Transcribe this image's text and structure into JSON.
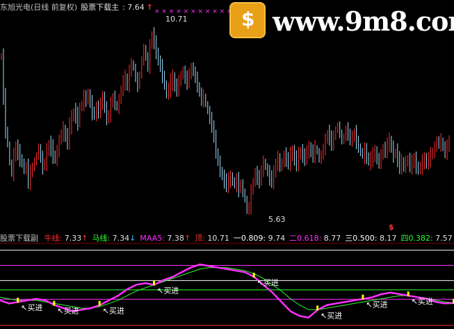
{
  "header": {
    "stock_name": "东旭光电(日线 前复权)",
    "indicator_label": "股票下载主",
    "indicator_value": ": 7.64",
    "up_arrow": "↑",
    "sell_marks": "× × × ×      × × ×  ×       × × ×"
  },
  "watermark": {
    "logo_text": "$",
    "site_text": "www.9m8.com"
  },
  "price_labels": {
    "high": "10.71",
    "low": "5.63"
  },
  "sub_header": {
    "title": "股票下载副",
    "items": [
      {
        "label": "牛线:",
        "value": "7.33",
        "arrow": "↑",
        "color": "#ff3030",
        "arrow_color": "#ff3030"
      },
      {
        "label": "马线:",
        "value": "7.34",
        "arrow": "↓",
        "color": "#30ff30",
        "arrow_color": "#30c0ff"
      },
      {
        "label": "MAA5:",
        "value": "7.38",
        "arrow": "↑",
        "color": "#ff30ff",
        "arrow_color": "#ff3030"
      },
      {
        "label": "顶:",
        "value": "10.71",
        "arrow": "",
        "color": "#ff3030",
        "arrow_color": "#ff3030"
      },
      {
        "label": "一0.809:",
        "value": "9.74",
        "arrow": "",
        "color": "#ffffff",
        "arrow_color": "#fff"
      },
      {
        "label": "二0.618:",
        "value": "8.77",
        "arrow": "",
        "color": "#ff30ff",
        "arrow_color": "#fff"
      },
      {
        "label": "三0.500:",
        "value": "8.17",
        "arrow": "",
        "color": "#ffffff",
        "arrow_color": "#fff"
      },
      {
        "label": "四0.382:",
        "value": "7.57",
        "arrow": "",
        "color": "#30ff30",
        "arrow_color": "#fff"
      }
    ],
    "dollar_mark": "$"
  },
  "buy_label": "买进",
  "colors": {
    "up": "#ff3030",
    "down": "#a0e0ff",
    "bull_line": "#ff30ff",
    "horse_line": "#30ff30",
    "slow_line": "#e0e0a0",
    "sell_mark": "#ff30ff",
    "buy_mark": "#ffff00"
  },
  "chart_data": [
    {
      "type": "line",
      "name": "price",
      "x": [
        0,
        1,
        2,
        3,
        4,
        5,
        6,
        7,
        8,
        9,
        10,
        11,
        12,
        13,
        14,
        15,
        16,
        17,
        18,
        19,
        20,
        21,
        22,
        23,
        24,
        25,
        26,
        27,
        28,
        29,
        30,
        31,
        32,
        33,
        34,
        35,
        36,
        37,
        38,
        39,
        40,
        41,
        42,
        43,
        44,
        45,
        46,
        47,
        48,
        49,
        50,
        51,
        52,
        53,
        54,
        55,
        56,
        57,
        58,
        59,
        60,
        61,
        62,
        63,
        64,
        65,
        66,
        67,
        68,
        69,
        70,
        71,
        72,
        73,
        74,
        75,
        76,
        77,
        78,
        79,
        80,
        81,
        82,
        83,
        84,
        85,
        86,
        87,
        88,
        89,
        90,
        91,
        92,
        93,
        94,
        95,
        96,
        97,
        98,
        99,
        100,
        101,
        102,
        103,
        104,
        105,
        106,
        107,
        108,
        109,
        110,
        111,
        112,
        113,
        114,
        115,
        116,
        117,
        118,
        119,
        120,
        121,
        122,
        123,
        124,
        125,
        126,
        127,
        128,
        129,
        130,
        131,
        132,
        133,
        134,
        135,
        136,
        137,
        138,
        139,
        140,
        141,
        142,
        143,
        144,
        145,
        146,
        147,
        148,
        149,
        150,
        151,
        152,
        153,
        154,
        155,
        156,
        157,
        158,
        159,
        160,
        161,
        162,
        163,
        164,
        165,
        166,
        167,
        168,
        169,
        170,
        171,
        172,
        173,
        174,
        175,
        176,
        177,
        178,
        179,
        180,
        181,
        182,
        183,
        184,
        185,
        186,
        187,
        188,
        189,
        190,
        191,
        192,
        193,
        194,
        195,
        196,
        197,
        198,
        199,
        200,
        201,
        202,
        203,
        204,
        205,
        206,
        207,
        208,
        209,
        210,
        211,
        212,
        213,
        214
      ],
      "values": [
        9.9,
        8.8,
        7.9,
        7.5,
        7.0,
        6.7,
        7.2,
        7.4,
        7.3,
        7.1,
        7.0,
        6.8,
        6.9,
        6.5,
        6.7,
        6.9,
        7.0,
        7.2,
        7.4,
        7.1,
        6.9,
        7.0,
        7.3,
        7.5,
        7.4,
        7.2,
        7.1,
        7.3,
        7.6,
        7.8,
        7.9,
        7.7,
        7.6,
        8.0,
        8.2,
        8.4,
        8.3,
        8.1,
        8.5,
        8.6,
        8.8,
        8.7,
        8.9,
        8.6,
        8.4,
        8.3,
        8.5,
        8.4,
        8.6,
        8.8,
        8.5,
        8.2,
        8.3,
        8.6,
        8.8,
        8.6,
        8.5,
        8.7,
        9.0,
        9.2,
        9.3,
        9.1,
        9.5,
        9.7,
        9.6,
        9.3,
        9.1,
        9.4,
        9.8,
        10.1,
        9.9,
        9.6,
        10.2,
        10.5,
        10.3,
        10.0,
        9.8,
        9.6,
        9.4,
        9.1,
        8.9,
        9.0,
        9.2,
        9.3,
        9.1,
        9.0,
        9.2,
        9.4,
        9.5,
        9.3,
        9.2,
        9.4,
        9.6,
        9.5,
        9.3,
        9.1,
        8.9,
        8.7,
        8.8,
        8.6,
        8.4,
        8.2,
        8.0,
        7.7,
        7.3,
        7.0,
        6.8,
        6.6,
        6.5,
        6.4,
        6.5,
        6.6,
        6.5,
        6.4,
        6.5,
        6.3,
        6.4,
        6.2,
        6.0,
        5.7,
        5.8,
        6.2,
        6.5,
        6.7,
        6.6,
        6.5,
        6.8,
        7.0,
        6.9,
        6.7,
        6.6,
        6.5,
        6.7,
        7.0,
        7.1,
        6.9,
        7.0,
        7.2,
        7.1,
        7.0,
        7.2,
        7.3,
        7.1,
        7.0,
        7.2,
        7.3,
        7.2,
        7.1,
        7.3,
        7.4,
        7.3,
        7.2,
        7.4,
        7.3,
        7.1,
        7.2,
        7.4,
        7.6,
        7.8,
        7.7,
        7.5,
        7.7,
        7.9,
        8.0,
        7.8,
        7.6,
        7.7,
        7.9,
        7.8,
        7.6,
        7.7,
        7.8,
        7.6,
        7.4,
        7.3,
        7.2,
        7.3,
        7.2,
        7.0,
        7.1,
        7.2,
        7.3,
        7.1,
        7.0,
        7.2,
        7.4,
        7.3,
        7.5,
        7.6,
        7.4,
        7.2,
        7.3,
        7.1,
        6.9,
        7.0,
        6.9,
        7.0,
        7.1,
        6.9,
        7.0,
        7.1,
        6.9,
        6.8,
        6.9,
        7.0,
        7.1,
        7.0,
        7.1,
        7.2,
        7.3,
        7.4,
        7.6,
        7.5,
        7.6,
        7.4,
        7.3,
        7.4,
        7.64
      ],
      "ylim": [
        5.4,
        11.1
      ]
    },
    {
      "type": "line",
      "name": "牛线",
      "values": [
        7.5,
        7.3,
        7.4,
        7.5,
        7.6,
        7.5,
        7.2,
        7.0,
        6.8,
        6.9,
        7.0,
        7.2,
        7.5,
        7.8,
        8.2,
        8.5,
        8.6,
        8.5,
        8.8,
        9.0,
        9.3,
        9.6,
        9.8,
        9.7,
        9.6,
        9.5,
        9.4,
        9.3,
        9.0,
        8.5,
        8.0,
        7.4,
        6.8,
        6.5,
        6.4,
        6.9,
        7.2,
        7.3,
        7.4,
        7.5,
        7.6,
        7.7,
        7.9,
        8.0,
        7.9,
        7.8,
        7.7,
        7.6,
        7.4,
        7.3,
        7.33
      ],
      "ylim": [
        5.8,
        10.7
      ]
    },
    {
      "type": "line",
      "name": "马线",
      "values": [
        7.7,
        7.6,
        7.5,
        7.5,
        7.5,
        7.4,
        7.3,
        7.2,
        7.1,
        7.0,
        7.0,
        7.1,
        7.3,
        7.5,
        7.8,
        8.1,
        8.3,
        8.5,
        8.7,
        8.9,
        9.1,
        9.3,
        9.5,
        9.6,
        9.6,
        9.6,
        9.5,
        9.4,
        9.2,
        8.9,
        8.5,
        8.1,
        7.6,
        7.2,
        6.9,
        6.9,
        7.0,
        7.1,
        7.2,
        7.3,
        7.4,
        7.5,
        7.6,
        7.7,
        7.8,
        7.8,
        7.7,
        7.6,
        7.5,
        7.4,
        7.34
      ],
      "ylim": [
        5.8,
        10.7
      ]
    }
  ],
  "sub_levels": [
    {
      "name": "顶",
      "value": 10.71,
      "color": "#ffffff"
    },
    {
      "name": "一0.809",
      "value": 9.74,
      "color": "#ff30ff"
    },
    {
      "name": "二0.618",
      "value": 8.77,
      "color": "#ffffff"
    },
    {
      "name": "三0.500",
      "value": 8.17,
      "color": "#30ff30"
    },
    {
      "name": "四0.382",
      "value": 7.57,
      "color": "#ff30ff"
    },
    {
      "name": "底",
      "value": 5.9,
      "color": "#ff3030"
    }
  ],
  "buy_signals": [
    2,
    6,
    11,
    17,
    28,
    35,
    40,
    45,
    50,
    62,
    65,
    69,
    75
  ]
}
